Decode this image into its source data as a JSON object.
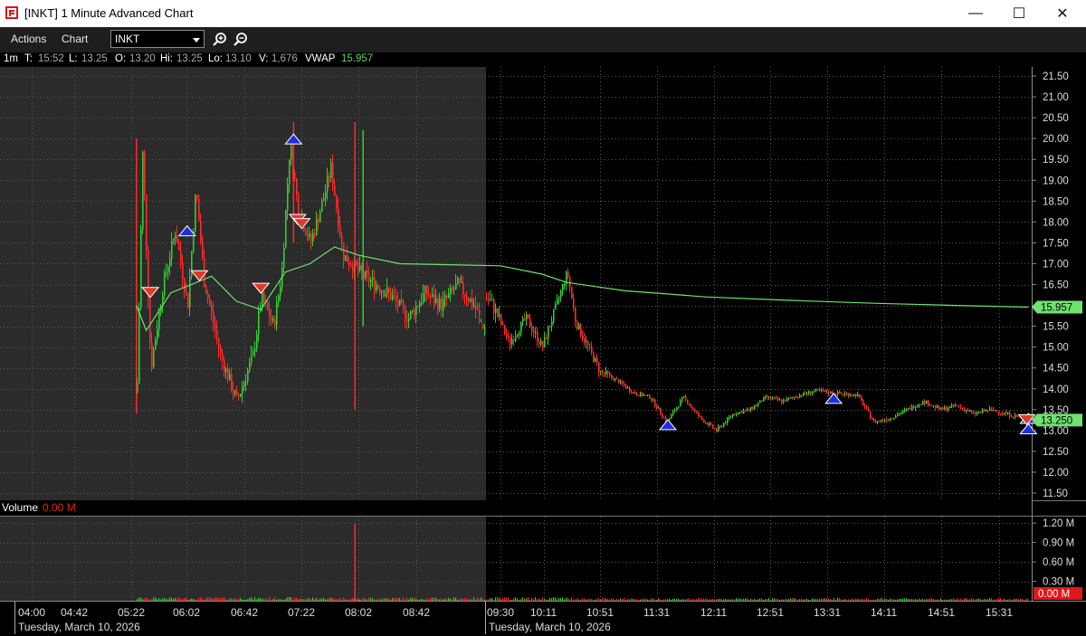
{
  "window": {
    "title": "[INKT] 1 Minute Advanced Chart",
    "minimize": "—",
    "maximize": "☐",
    "close": "✕"
  },
  "menu": {
    "actions": "Actions",
    "chart": "Chart"
  },
  "symbol": "INKT",
  "info": {
    "interval": "1m",
    "t_label": "T:",
    "t_val": "15:52",
    "l_label": "L:",
    "l_val": "13.25",
    "o_label": "O:",
    "o_val": "13.20",
    "hi_label": "Hi:",
    "hi_val": "13.25",
    "lo_label": "Lo:",
    "lo_val": "13.10",
    "v_label": "V:",
    "v_val": "1,676",
    "vwap_label": "VWAP",
    "vwap_val": "15.957"
  },
  "volume": {
    "label": "Volume",
    "value": "0.00 M"
  },
  "colors": {
    "up": "#33cc33",
    "down": "#ff2a2a",
    "vwap": "#6fe26f",
    "premarket_bg": "#2b2b2b",
    "buy_marker": "#1f2fe0",
    "sell_marker": "#e03a2a"
  },
  "chart_data": [
    {
      "type": "candlestick",
      "price_axis": [
        "21.50",
        "21.00",
        "20.50",
        "20.00",
        "19.50",
        "19.00",
        "18.50",
        "18.00",
        "17.50",
        "17.00",
        "16.50",
        "16.00",
        "15.50",
        "15.00",
        "14.50",
        "14.00",
        "13.50",
        "13.00",
        "12.50",
        "12.00",
        "11.50"
      ],
      "ylim": [
        11.3,
        21.7
      ],
      "x_ticks": [
        "04:00",
        "04:42",
        "05:22",
        "06:02",
        "06:42",
        "07:22",
        "08:02",
        "08:42",
        "09:30",
        "10:11",
        "10:51",
        "11:31",
        "12:11",
        "12:51",
        "13:31",
        "14:11",
        "14:51",
        "15:31"
      ],
      "x_dates": [
        "Tuesday, March 10, 2026",
        "Tuesday, March 10, 2026"
      ],
      "current_vwap_tag": "15.957",
      "current_price_tag": "13.250",
      "vwap_path": [
        [
          5.28,
          16.0
        ],
        [
          5.4,
          15.4
        ],
        [
          5.7,
          16.3
        ],
        [
          6.2,
          16.7
        ],
        [
          6.5,
          16.1
        ],
        [
          6.8,
          15.9
        ],
        [
          7.1,
          16.8
        ],
        [
          7.4,
          17.0
        ],
        [
          7.7,
          17.4
        ],
        [
          8.0,
          17.2
        ],
        [
          8.5,
          17.0
        ],
        [
          9.5,
          16.95
        ],
        [
          10.0,
          16.75
        ],
        [
          10.3,
          16.55
        ],
        [
          11.0,
          16.35
        ],
        [
          12.0,
          16.2
        ],
        [
          13.0,
          16.12
        ],
        [
          14.0,
          16.05
        ],
        [
          15.0,
          16.0
        ],
        [
          15.87,
          15.957
        ]
      ],
      "price_path": [
        [
          5.28,
          13.9
        ],
        [
          5.35,
          19.7
        ],
        [
          5.45,
          14.5
        ],
        [
          5.6,
          16.5
        ],
        [
          5.75,
          17.8
        ],
        [
          5.9,
          16.0
        ],
        [
          6.0,
          18.8
        ],
        [
          6.1,
          16.6
        ],
        [
          6.3,
          14.8
        ],
        [
          6.5,
          13.7
        ],
        [
          6.7,
          14.8
        ],
        [
          6.8,
          16.2
        ],
        [
          6.95,
          15.5
        ],
        [
          7.05,
          16.8
        ],
        [
          7.15,
          19.9
        ],
        [
          7.25,
          18.3
        ],
        [
          7.4,
          17.5
        ],
        [
          7.55,
          18.5
        ],
        [
          7.65,
          19.3
        ],
        [
          7.8,
          17.2
        ],
        [
          7.95,
          16.9
        ],
        [
          8.05,
          16.7
        ],
        [
          8.2,
          16.5
        ],
        [
          8.4,
          16.2
        ],
        [
          8.6,
          15.7
        ],
        [
          8.8,
          16.3
        ],
        [
          9.0,
          16.0
        ],
        [
          9.2,
          16.5
        ],
        [
          9.4,
          16.0
        ],
        [
          9.6,
          15.1
        ],
        [
          9.8,
          15.7
        ],
        [
          10.0,
          15.0
        ],
        [
          10.2,
          16.2
        ],
        [
          10.3,
          16.8
        ],
        [
          10.4,
          15.6
        ],
        [
          10.5,
          15.2
        ],
        [
          10.7,
          14.4
        ],
        [
          10.9,
          14.2
        ],
        [
          11.1,
          13.9
        ],
        [
          11.3,
          13.8
        ],
        [
          11.5,
          13.2
        ],
        [
          11.7,
          13.8
        ],
        [
          11.9,
          13.3
        ],
        [
          12.1,
          13.0
        ],
        [
          12.3,
          13.4
        ],
        [
          12.5,
          13.5
        ],
        [
          12.7,
          13.8
        ],
        [
          12.9,
          13.7
        ],
        [
          13.1,
          13.85
        ],
        [
          13.3,
          13.95
        ],
        [
          13.5,
          13.9
        ],
        [
          13.8,
          13.85
        ],
        [
          14.0,
          13.2
        ],
        [
          14.2,
          13.3
        ],
        [
          14.4,
          13.5
        ],
        [
          14.6,
          13.7
        ],
        [
          14.8,
          13.5
        ],
        [
          15.0,
          13.6
        ],
        [
          15.2,
          13.4
        ],
        [
          15.4,
          13.5
        ],
        [
          15.6,
          13.4
        ],
        [
          15.87,
          13.25
        ]
      ],
      "spikes": [
        [
          5.28,
          13.4,
          20.0
        ],
        [
          7.2,
          17.5,
          20.4
        ],
        [
          7.95,
          13.5,
          20.4
        ],
        [
          8.05,
          15.5,
          20.2
        ]
      ],
      "buy_markers": [
        [
          5.9,
          17.8
        ],
        [
          7.2,
          20.0
        ],
        [
          11.52,
          13.15
        ],
        [
          13.52,
          13.78
        ],
        [
          15.87,
          13.3
        ],
        [
          15.87,
          13.05
        ]
      ],
      "sell_markers": [
        [
          5.45,
          16.3
        ],
        [
          6.05,
          16.7
        ],
        [
          6.8,
          16.4
        ],
        [
          7.25,
          18.05
        ],
        [
          7.3,
          17.95
        ],
        [
          15.85,
          13.25
        ]
      ]
    },
    {
      "type": "bar",
      "title": "Volume",
      "volume_axis": [
        "1.20 M",
        "0.90 M",
        "0.60 M",
        "0.30 M"
      ],
      "current_volume_tag": "0.00 M",
      "ylim": [
        0,
        1.3
      ],
      "spike": {
        "x": 7.95,
        "value": 1.2
      }
    }
  ]
}
